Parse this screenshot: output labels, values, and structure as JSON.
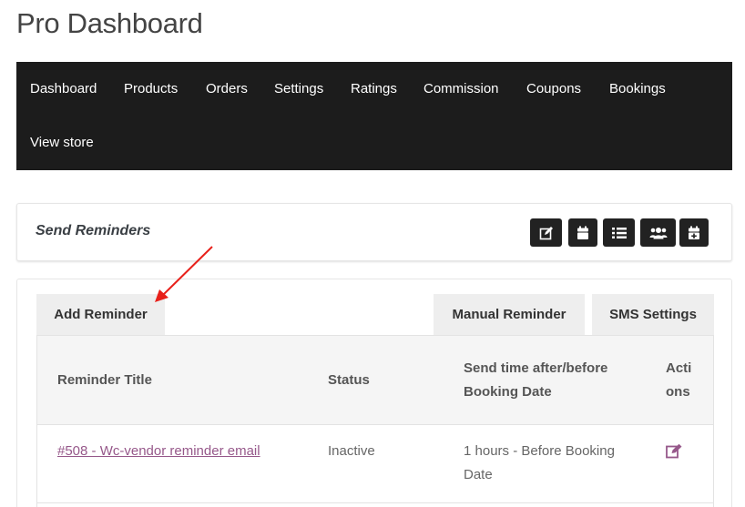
{
  "page": {
    "title": "Pro Dashboard"
  },
  "nav": {
    "items": [
      {
        "label": "Dashboard"
      },
      {
        "label": "Products"
      },
      {
        "label": "Orders"
      },
      {
        "label": "Settings"
      },
      {
        "label": "Ratings"
      },
      {
        "label": "Commission"
      },
      {
        "label": "Coupons"
      },
      {
        "label": "Bookings"
      },
      {
        "label": "View store"
      }
    ]
  },
  "reminders_header": {
    "title": "Send Reminders",
    "icons": [
      "edit-icon",
      "calendar-icon",
      "list-icon",
      "users-icon",
      "calendar-plus-icon"
    ]
  },
  "tabs": {
    "add": "Add Reminder",
    "manual": "Manual Reminder",
    "sms": "SMS Settings"
  },
  "table": {
    "columns": {
      "title": "Reminder Title",
      "status": "Status",
      "send_time_line1": "Send time after/before",
      "send_time_line2": "Booking Date",
      "actions_line1": "Acti",
      "actions_line2": "ons"
    },
    "rows": [
      {
        "title": "#508 - Wc-vendor reminder email",
        "status": "Inactive",
        "send_time_line1": "1 hours - Before Booking",
        "send_time_line2": "Date"
      }
    ]
  },
  "colors": {
    "nav_bg": "#1c1c1c",
    "link": "#96588a",
    "annotation_arrow": "#e8201a"
  }
}
